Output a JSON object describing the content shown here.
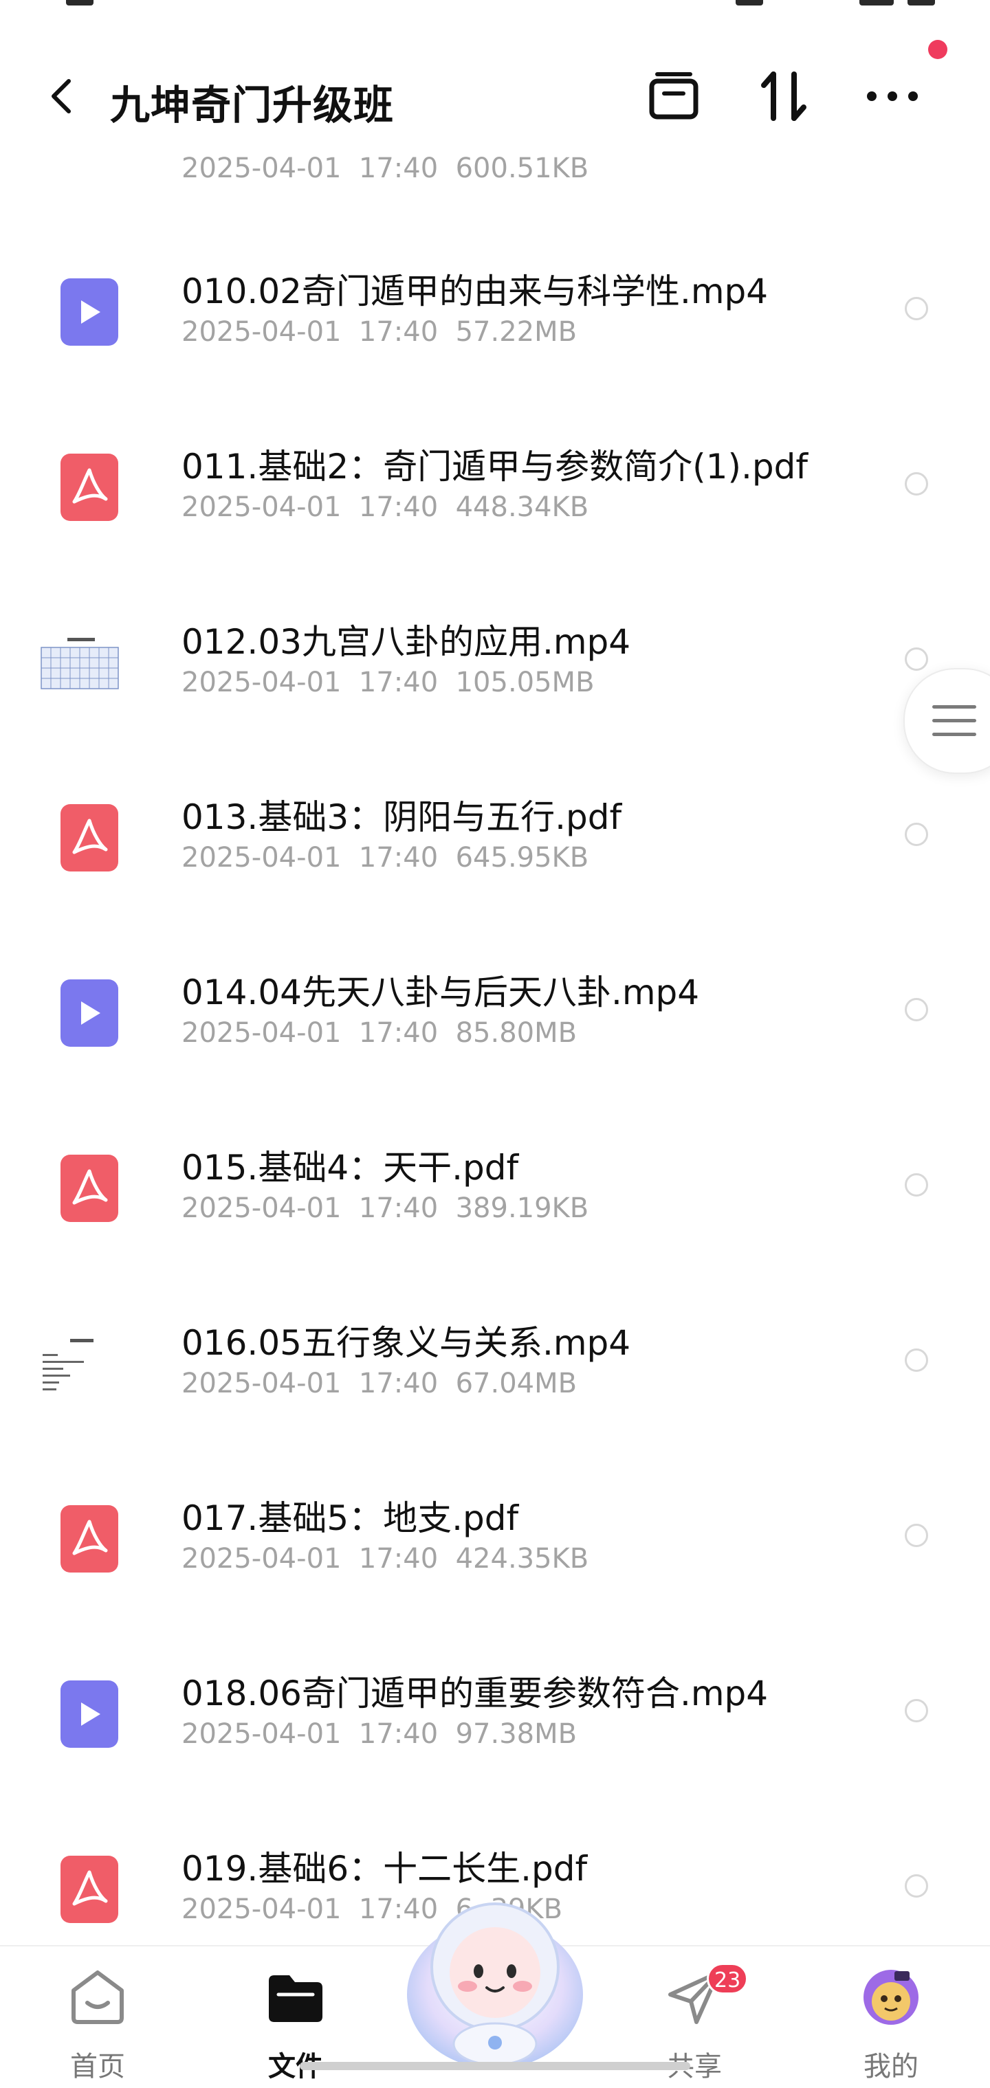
{
  "header": {
    "title": "九坤奇门升级班"
  },
  "first_item_meta": "2025-04-01  17:40  600.51KB",
  "files": [
    {
      "name": "010.02奇门遁甲的由来与科学性.mp4",
      "meta": "2025-04-01  17:40  57.22MB",
      "type": "mp4"
    },
    {
      "name": "011.基础2：奇门遁甲与参数简介(1).pdf",
      "meta": "2025-04-01  17:40  448.34KB",
      "type": "pdf"
    },
    {
      "name": "012.03九宫八卦的应用.mp4",
      "meta": "2025-04-01  17:40  105.05MB",
      "type": "thumb"
    },
    {
      "name": "013.基础3：阴阳与五行.pdf",
      "meta": "2025-04-01  17:40  645.95KB",
      "type": "pdf"
    },
    {
      "name": "014.04先天八卦与后天八卦.mp4",
      "meta": "2025-04-01  17:40  85.80MB",
      "type": "mp4"
    },
    {
      "name": "015.基础4：天干.pdf",
      "meta": "2025-04-01  17:40  389.19KB",
      "type": "pdf"
    },
    {
      "name": "016.05五行象义与关系.mp4",
      "meta": "2025-04-01  17:40  67.04MB",
      "type": "thumb2"
    },
    {
      "name": "017.基础5：地支.pdf",
      "meta": "2025-04-01  17:40  424.35KB",
      "type": "pdf"
    },
    {
      "name": "018.06奇门遁甲的重要参数符合.mp4",
      "meta": "2025-04-01  17:40  97.38MB",
      "type": "mp4"
    },
    {
      "name": "019.基础6：十二长生.pdf",
      "meta": "2025-04-01  17:40  6 .39KB",
      "type": "pdf"
    }
  ],
  "nav": {
    "home": "首页",
    "files": "文件",
    "share": "共享",
    "share_badge": "23",
    "mine": "我的"
  },
  "colors": {
    "pdf_icon": "#f05d68",
    "video_icon": "#7b78ee",
    "badge": "#ee3e57",
    "notification_dot": "#ef3b5d"
  }
}
